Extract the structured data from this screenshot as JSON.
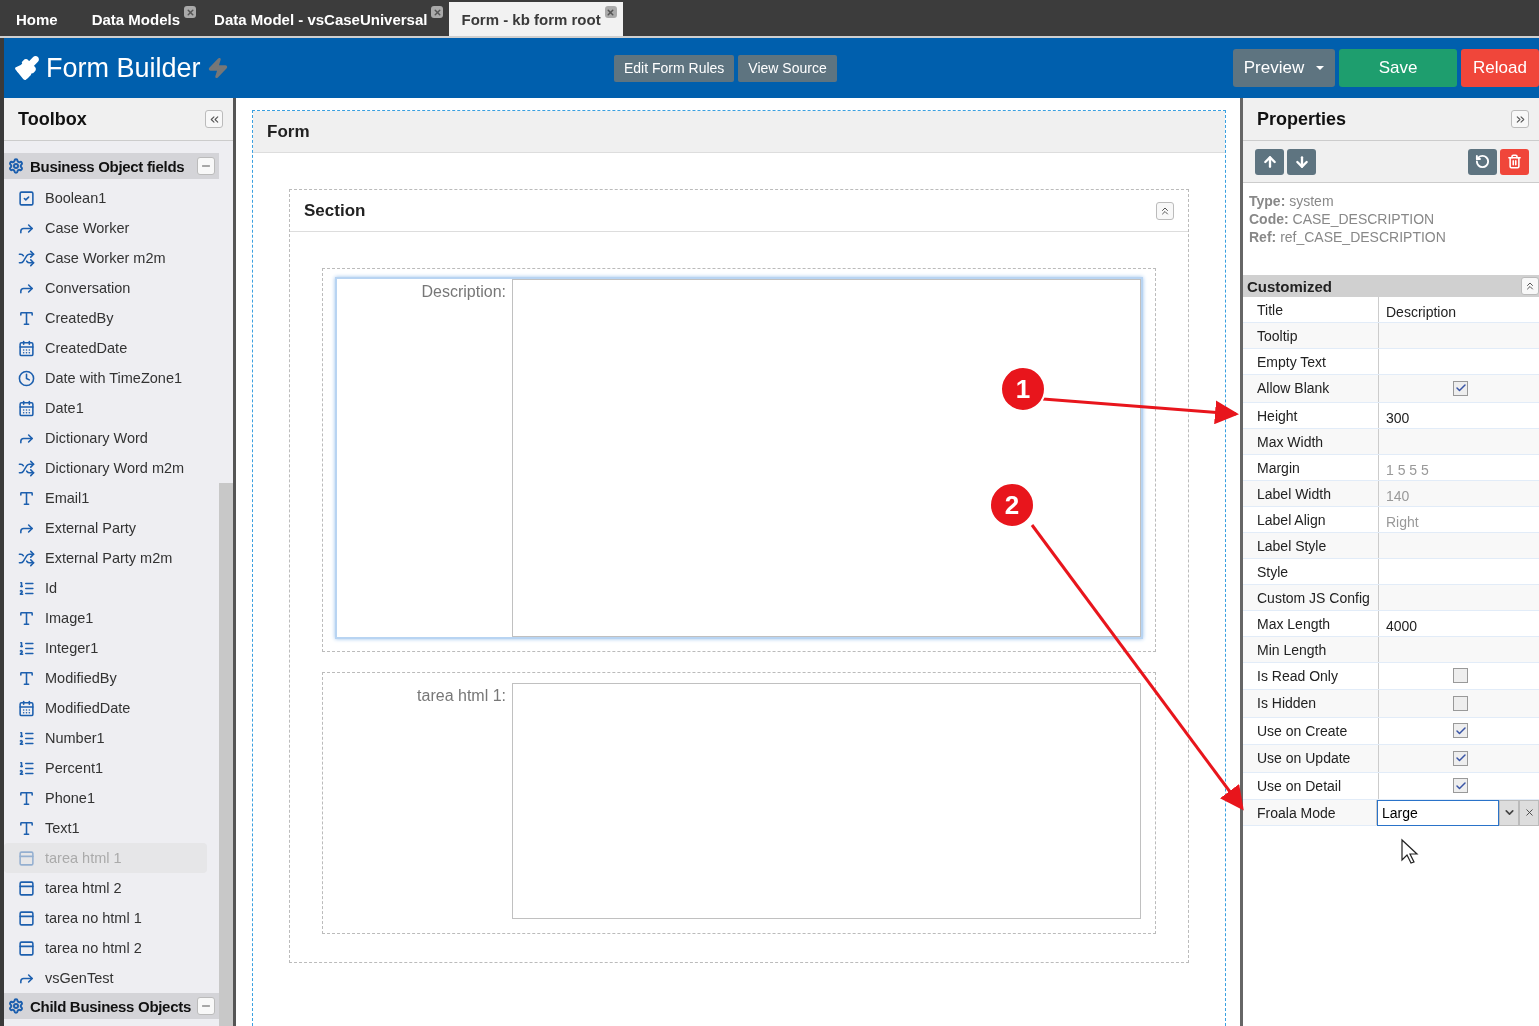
{
  "tabs": [
    {
      "label": "Home",
      "selected": false,
      "closable": false
    },
    {
      "label": "Data Models",
      "selected": false,
      "closable": true
    },
    {
      "label": "Data Model - vsCaseUniversal",
      "selected": false,
      "closable": true
    },
    {
      "label": "Form - kb form root",
      "selected": true,
      "closable": true
    }
  ],
  "header": {
    "title": "Form Builder",
    "center_buttons": [
      "Edit Form Rules",
      "View Source"
    ],
    "buttons": [
      {
        "label": "Preview",
        "kind": "dropdown"
      },
      {
        "label": "Save",
        "kind": "success"
      },
      {
        "label": "Reload",
        "kind": "danger"
      }
    ]
  },
  "toolbox": {
    "title": "Toolbox",
    "groups": [
      {
        "label": "Business Object fields",
        "expanded": true,
        "items": [
          {
            "label": "Boolean1",
            "kind": "check",
            "disabled": false
          },
          {
            "label": "Case Worker",
            "kind": "share",
            "disabled": false
          },
          {
            "label": "Case Worker m2m",
            "kind": "shuffle",
            "disabled": false
          },
          {
            "label": "Conversation",
            "kind": "share",
            "disabled": false
          },
          {
            "label": "CreatedBy",
            "kind": "text",
            "disabled": false
          },
          {
            "label": "CreatedDate",
            "kind": "calendar",
            "disabled": false
          },
          {
            "label": "Date with TimeZone1",
            "kind": "clock",
            "disabled": false
          },
          {
            "label": "Date1",
            "kind": "calendar",
            "disabled": false
          },
          {
            "label": "Dictionary Word",
            "kind": "share",
            "disabled": false
          },
          {
            "label": "Dictionary Word m2m",
            "kind": "shuffle",
            "disabled": false
          },
          {
            "label": "Email1",
            "kind": "text",
            "disabled": false
          },
          {
            "label": "External Party",
            "kind": "share",
            "disabled": false
          },
          {
            "label": "External Party m2m",
            "kind": "shuffle",
            "disabled": false
          },
          {
            "label": "Id",
            "kind": "list",
            "disabled": false
          },
          {
            "label": "Image1",
            "kind": "text",
            "disabled": false
          },
          {
            "label": "Integer1",
            "kind": "list",
            "disabled": false
          },
          {
            "label": "ModifiedBy",
            "kind": "text",
            "disabled": false
          },
          {
            "label": "ModifiedDate",
            "kind": "calendar",
            "disabled": false
          },
          {
            "label": "Number1",
            "kind": "list",
            "disabled": false
          },
          {
            "label": "Percent1",
            "kind": "list",
            "disabled": false
          },
          {
            "label": "Phone1",
            "kind": "text",
            "disabled": false
          },
          {
            "label": "Text1",
            "kind": "text",
            "disabled": false
          },
          {
            "label": "tarea html 1",
            "kind": "textarea",
            "disabled": true
          },
          {
            "label": "tarea html 2",
            "kind": "textarea",
            "disabled": false
          },
          {
            "label": "tarea no html 1",
            "kind": "textarea",
            "disabled": false
          },
          {
            "label": "tarea no html 2",
            "kind": "textarea",
            "disabled": false
          },
          {
            "label": "vsGenTest",
            "kind": "share",
            "disabled": false
          }
        ]
      },
      {
        "label": "Child Business Objects",
        "expanded": true
      }
    ]
  },
  "form": {
    "title": "Form",
    "section": {
      "title": "Section",
      "fields": [
        {
          "label": "Description:",
          "selected": true,
          "tall": true
        },
        {
          "label": "tarea html 1:",
          "selected": false,
          "tall": false
        }
      ]
    }
  },
  "properties": {
    "title": "Properties",
    "info": [
      {
        "label": "Type:",
        "value": "system"
      },
      {
        "label": "Code:",
        "value": "CASE_DESCRIPTION"
      },
      {
        "label": "Ref:",
        "value": "ref_CASE_DESCRIPTION"
      }
    ],
    "group": "Customized",
    "rows": [
      {
        "name": "Title",
        "kind": "text",
        "value": "Description",
        "muted": false
      },
      {
        "name": "Tooltip",
        "kind": "text"
      },
      {
        "name": "Empty Text",
        "kind": "text"
      },
      {
        "name": "Allow Blank",
        "kind": "checkbox",
        "checked": true
      },
      {
        "name": "Height",
        "kind": "text",
        "value": "300",
        "muted": false
      },
      {
        "name": "Max Width",
        "kind": "text"
      },
      {
        "name": "Margin",
        "kind": "text",
        "value": "1 5 5 5",
        "muted": true
      },
      {
        "name": "Label Width",
        "kind": "text",
        "value": "140",
        "muted": true
      },
      {
        "name": "Label Align",
        "kind": "text",
        "value": "Right",
        "muted": true
      },
      {
        "name": "Label Style",
        "kind": "text"
      },
      {
        "name": "Style",
        "kind": "text"
      },
      {
        "name": "Custom JS Config",
        "kind": "text"
      },
      {
        "name": "Max Length",
        "kind": "text",
        "value": "4000",
        "muted": false
      },
      {
        "name": "Min Length",
        "kind": "text"
      },
      {
        "name": "Is Read Only",
        "kind": "checkbox",
        "checked": false
      },
      {
        "name": "Is Hidden",
        "kind": "checkbox",
        "checked": false
      },
      {
        "name": "Use on Create",
        "kind": "checkbox",
        "checked": true
      },
      {
        "name": "Use on Update",
        "kind": "checkbox",
        "checked": true
      },
      {
        "name": "Use on Detail",
        "kind": "checkbox",
        "checked": true
      },
      {
        "name": "Froala Mode",
        "kind": "select",
        "value": "Large"
      }
    ]
  },
  "annotations": [
    {
      "label": "1"
    },
    {
      "label": "2"
    }
  ]
}
